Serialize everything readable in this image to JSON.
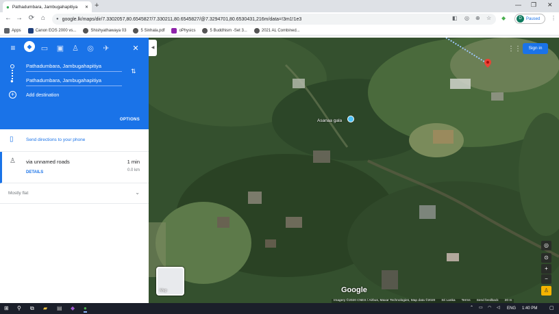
{
  "browser": {
    "tab_title": "Pathadumbara, Jambugahapitiya",
    "new_tab": "+",
    "minimize": "—",
    "maximize": "❐",
    "close": "✕",
    "back": "←",
    "forward": "→",
    "reload": "⟳",
    "home": "⌂",
    "lock": "🔒",
    "url": "google.lk/maps/dir/7.3302057,80.6545827/7.330211,80.6545827/@7.3294701,80.6530431,216m/data=!3m1!1e3",
    "profile_initial": "D",
    "profile_status": "Paused",
    "menu": "⋮"
  },
  "bookmarks": [
    {
      "label": "Apps",
      "color": "#5f6368"
    },
    {
      "label": "Canon EOS 2000 vs...",
      "color": "#1f3f7a"
    },
    {
      "label": "Shishyathawaya 03",
      "color": "#555555"
    },
    {
      "label": "5 Sinhala.pdf",
      "color": "#555555"
    },
    {
      "label": "oPhysics",
      "color": "#8e24aa"
    },
    {
      "label": "5 Buddhism -Set 3...",
      "color": "#555555"
    },
    {
      "label": "2021 AL Combined...",
      "color": "#555555"
    }
  ],
  "panel": {
    "menu_icon": "≡",
    "close_icon": "✕",
    "origin": "Pathadumbara, Jambugahapitiya",
    "destination": "Pathadumbara, Jambugahapitiya",
    "add_destination": "Add destination",
    "options": "OPTIONS",
    "send_to_phone": "Send directions to your phone",
    "route_via": "via unnamed roads",
    "route_time": "1 min",
    "route_distance": "0.0 km",
    "details": "DETAILS",
    "elevation": "Mostly flat"
  },
  "map": {
    "place_label": "Asanaa gala",
    "sign_in": "Sign in",
    "minimap_label": "Map",
    "google": "Google",
    "attribution": [
      "Imagery ©2020 CNES / Airbus, Maxar Technologies, Map data ©2020",
      "Sri Lanka",
      "Terms",
      "Send feedback",
      "20 m"
    ],
    "zoom_in": "+",
    "zoom_out": "−"
  },
  "taskbar": {
    "language": "ENG",
    "time": "1:40 PM"
  }
}
